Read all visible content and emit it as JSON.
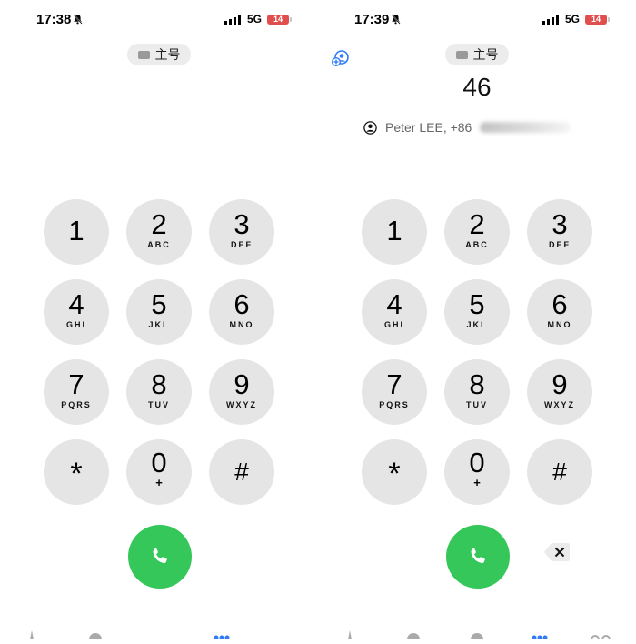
{
  "left": {
    "status": {
      "time": "17:38",
      "network": "5G",
      "battery": "14"
    },
    "sim_label": "主号",
    "keypad": [
      {
        "digit": "1",
        "letters": ""
      },
      {
        "digit": "2",
        "letters": "ABC"
      },
      {
        "digit": "3",
        "letters": "DEF"
      },
      {
        "digit": "4",
        "letters": "GHI"
      },
      {
        "digit": "5",
        "letters": "JKL"
      },
      {
        "digit": "6",
        "letters": "MNO"
      },
      {
        "digit": "7",
        "letters": "PQRS"
      },
      {
        "digit": "8",
        "letters": "TUV"
      },
      {
        "digit": "9",
        "letters": "WXYZ"
      },
      {
        "digit": "*",
        "letters": ""
      },
      {
        "digit": "0",
        "letters": "+"
      },
      {
        "digit": "#",
        "letters": ""
      }
    ]
  },
  "right": {
    "status": {
      "time": "17:39",
      "network": "5G",
      "battery": "14"
    },
    "sim_label": "主号",
    "dialed_number": "46",
    "contact_suggestion": "Peter LEE, +86",
    "keypad": [
      {
        "digit": "1",
        "letters": ""
      },
      {
        "digit": "2",
        "letters": "ABC"
      },
      {
        "digit": "3",
        "letters": "DEF"
      },
      {
        "digit": "4",
        "letters": "GHI"
      },
      {
        "digit": "5",
        "letters": "JKL"
      },
      {
        "digit": "6",
        "letters": "MNO"
      },
      {
        "digit": "7",
        "letters": "PQRS"
      },
      {
        "digit": "8",
        "letters": "TUV"
      },
      {
        "digit": "9",
        "letters": "WXYZ"
      },
      {
        "digit": "*",
        "letters": ""
      },
      {
        "digit": "0",
        "letters": "+"
      },
      {
        "digit": "#",
        "letters": ""
      }
    ]
  },
  "icons": {
    "bell": "bell-slash-icon",
    "signal": "signal-bars-icon",
    "add_contact": "add-contact-icon",
    "person": "person-circle-icon",
    "call": "phone-icon",
    "delete": "backspace-icon"
  },
  "colors": {
    "call_green": "#35c759",
    "key_gray": "#e5e5e5",
    "battery_red": "#e04e4e",
    "accent_blue": "#2f7cf6"
  }
}
